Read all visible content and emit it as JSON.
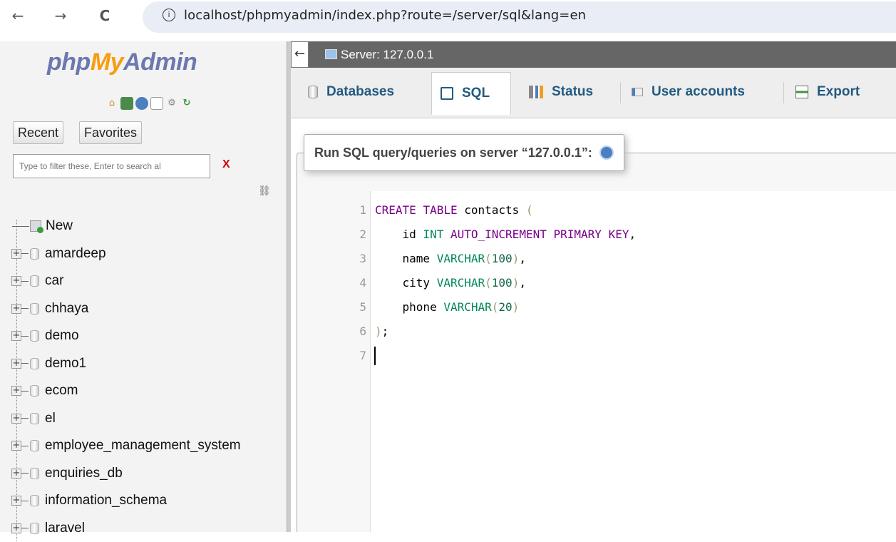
{
  "browser": {
    "back": "←",
    "forward": "→",
    "reload": "C",
    "info": "i",
    "url": "localhost/phpmyadmin/index.php?route=/server/sql&lang=en"
  },
  "sidebar": {
    "logo": {
      "php": "php",
      "my": "My",
      "admin": "Admin"
    },
    "tabs": [
      "Recent",
      "Favorites"
    ],
    "filter_placeholder": "Type to filter these, Enter to search al",
    "filter_clear": "X",
    "new_label": "New",
    "databases": [
      "amardeep",
      "car",
      "chhaya",
      "demo",
      "demo1",
      "ecom",
      "el",
      "employee_management_system",
      "enquiries_db",
      "information_schema",
      "laravel"
    ]
  },
  "server_bar": {
    "back": "←",
    "label": "Server: 127.0.0.1"
  },
  "tabs": [
    {
      "label": "Databases",
      "active": false
    },
    {
      "label": "SQL",
      "active": true
    },
    {
      "label": "Status",
      "active": false
    },
    {
      "label": "User accounts",
      "active": false
    },
    {
      "label": "Export",
      "active": false
    }
  ],
  "query_panel": {
    "legend": "Run SQL query/queries on server “127.0.0.1”:"
  },
  "editor": {
    "line_numbers": [
      "1",
      "2",
      "3",
      "4",
      "5",
      "6",
      "7"
    ],
    "lines": [
      "CREATE TABLE contacts (",
      "    id INT AUTO_INCREMENT PRIMARY KEY,",
      "    name VARCHAR(100),",
      "    city VARCHAR(100),",
      "    phone VARCHAR(20)",
      ");",
      ""
    ]
  },
  "colors": {
    "accent": "#235a81",
    "logo_blue": "#6c78af",
    "logo_orange": "#f89c0e"
  }
}
